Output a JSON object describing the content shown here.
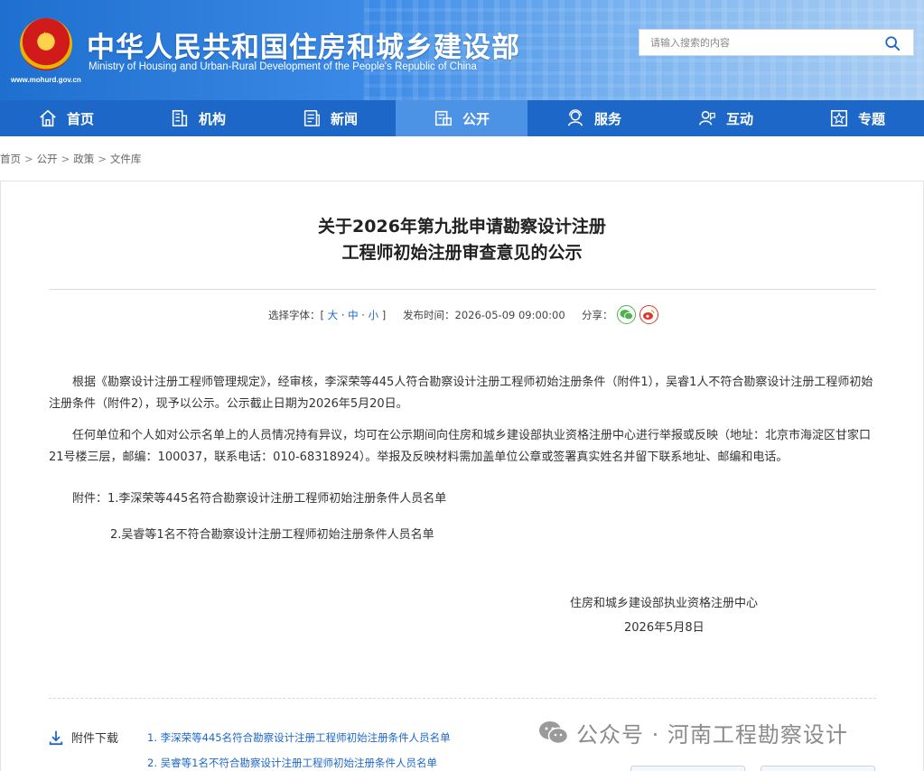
{
  "header": {
    "title_cn": "中华人民共和国住房和城乡建设部",
    "title_en": "Ministry of Housing and Urban-Rural Development of the People's Republic of China",
    "site_url": "www.mohurd.gov.cn",
    "search_placeholder": "请输入搜索的内容"
  },
  "nav": {
    "items": [
      {
        "label": "首页",
        "icon": "home-icon"
      },
      {
        "label": "机构",
        "icon": "building-icon"
      },
      {
        "label": "新闻",
        "icon": "news-icon"
      },
      {
        "label": "公开",
        "icon": "open-icon"
      },
      {
        "label": "服务",
        "icon": "service-icon"
      },
      {
        "label": "互动",
        "icon": "interact-icon"
      },
      {
        "label": "专题",
        "icon": "topic-icon"
      }
    ],
    "active": "公开",
    "colors": {
      "bar": "#1d67c9",
      "active": "#4c92e5"
    }
  },
  "breadcrumb": [
    "首页",
    "公开",
    "政策",
    "文件库"
  ],
  "article": {
    "title_line1": "关于2026年第九批申请勘察设计注册",
    "title_line2": "工程师初始注册审查意见的公示",
    "font_select_label": "选择字体：[",
    "font_large": "大",
    "font_medium": "中",
    "font_small": "小",
    "font_select_end": "]",
    "dot": "·",
    "pubtime": "发布时间：2026-05-09 09:00:00",
    "share_label": "分享：",
    "para1": "根据《勘察设计注册工程师管理规定》，经审核，李深荣等445人符合勘察设计注册工程师初始注册条件（附件1），吴睿1人不符合勘察设计注册工程师初始注册条件（附件2），现予以公示。公示截止日期为2026年5月20日。",
    "para2": "任何单位和个人如对公示名单上的人员情况持有异议，均可在公示期间向住房和城乡建设部执业资格注册中心进行举报或反映（地址：北京市海淀区甘家口21号楼三层，邮编：100037，联系电话：010-68318924）。举报及反映材料需加盖单位公章或签署真实姓名并留下联系地址、邮编和电话。",
    "attach1": "附件：1.李深荣等445名符合勘察设计注册工程师初始注册条件人员名单",
    "attach2": "2.吴睿等1名不符合勘察设计注册工程师初始注册条件人员名单",
    "issuer": "住房和城乡建设部执业资格注册中心",
    "date": "2026年5月8日"
  },
  "downloads": {
    "label": "附件下载",
    "links": [
      "1. 李深荣等445名符合勘察设计注册工程师初始注册条件人员名单",
      "2. 吴睿等1名不符合勘察设计注册工程师初始注册条件人员名单"
    ]
  },
  "watermark": "公众号 · 河南工程勘察设计"
}
